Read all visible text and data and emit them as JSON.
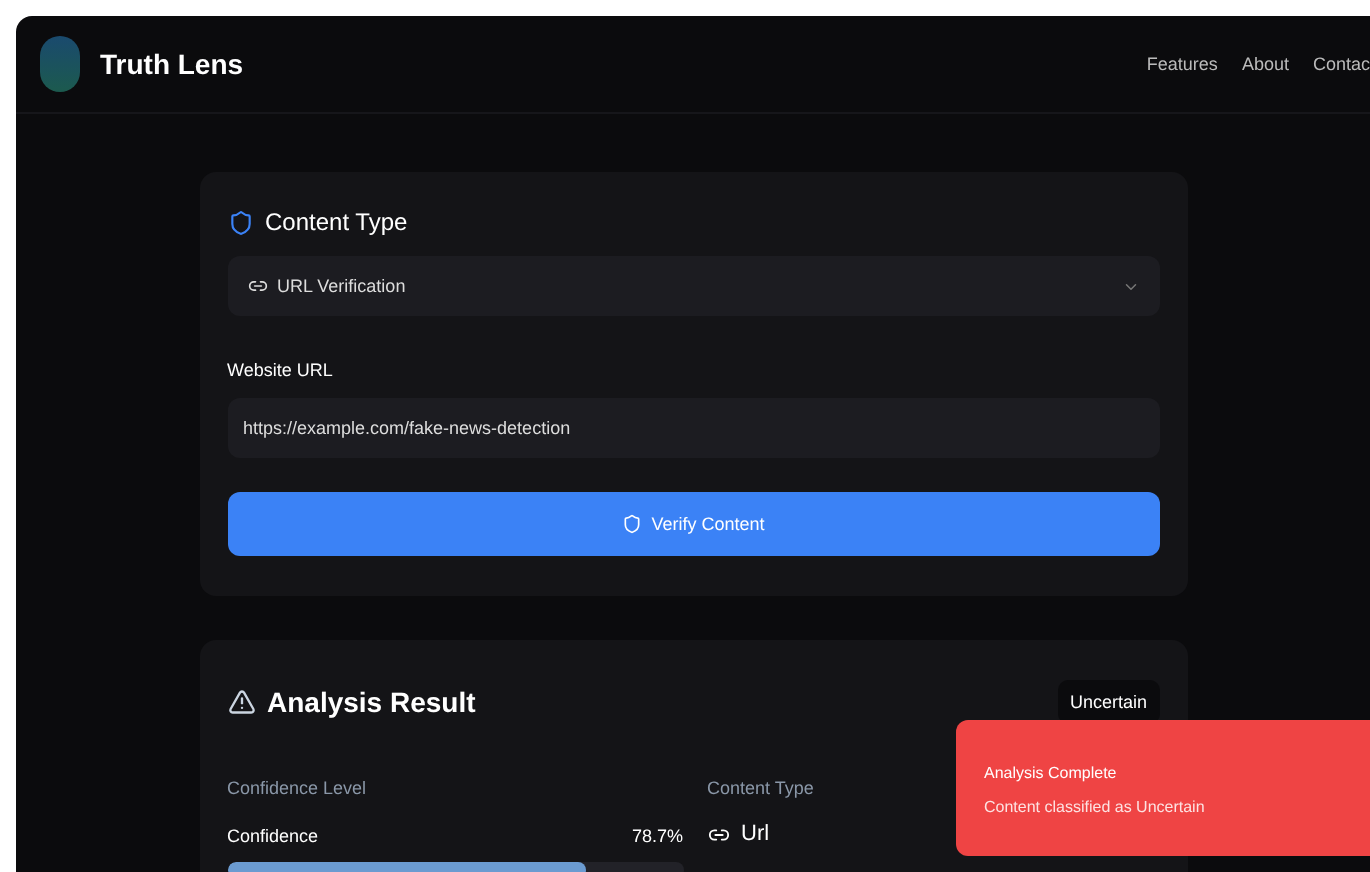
{
  "header": {
    "brand": "Truth Lens",
    "nav": [
      "Features",
      "About",
      "Contac"
    ]
  },
  "form": {
    "title": "Content Type",
    "select": {
      "value": "URL Verification"
    },
    "url_label": "Website URL",
    "url": {
      "value": "https://example.com/fake-news-detection"
    },
    "submit": "Verify Content"
  },
  "result": {
    "title": "Analysis Result",
    "badge": "Uncertain",
    "confidence_heading": "Confidence Level",
    "confidence_label": "Confidence",
    "confidence_value": "78.7%",
    "level": 0.787,
    "type_heading": "Content Type",
    "type_value": "Url"
  },
  "toast": {
    "title": "Analysis Complete",
    "message": "Content classified as Uncertain"
  }
}
